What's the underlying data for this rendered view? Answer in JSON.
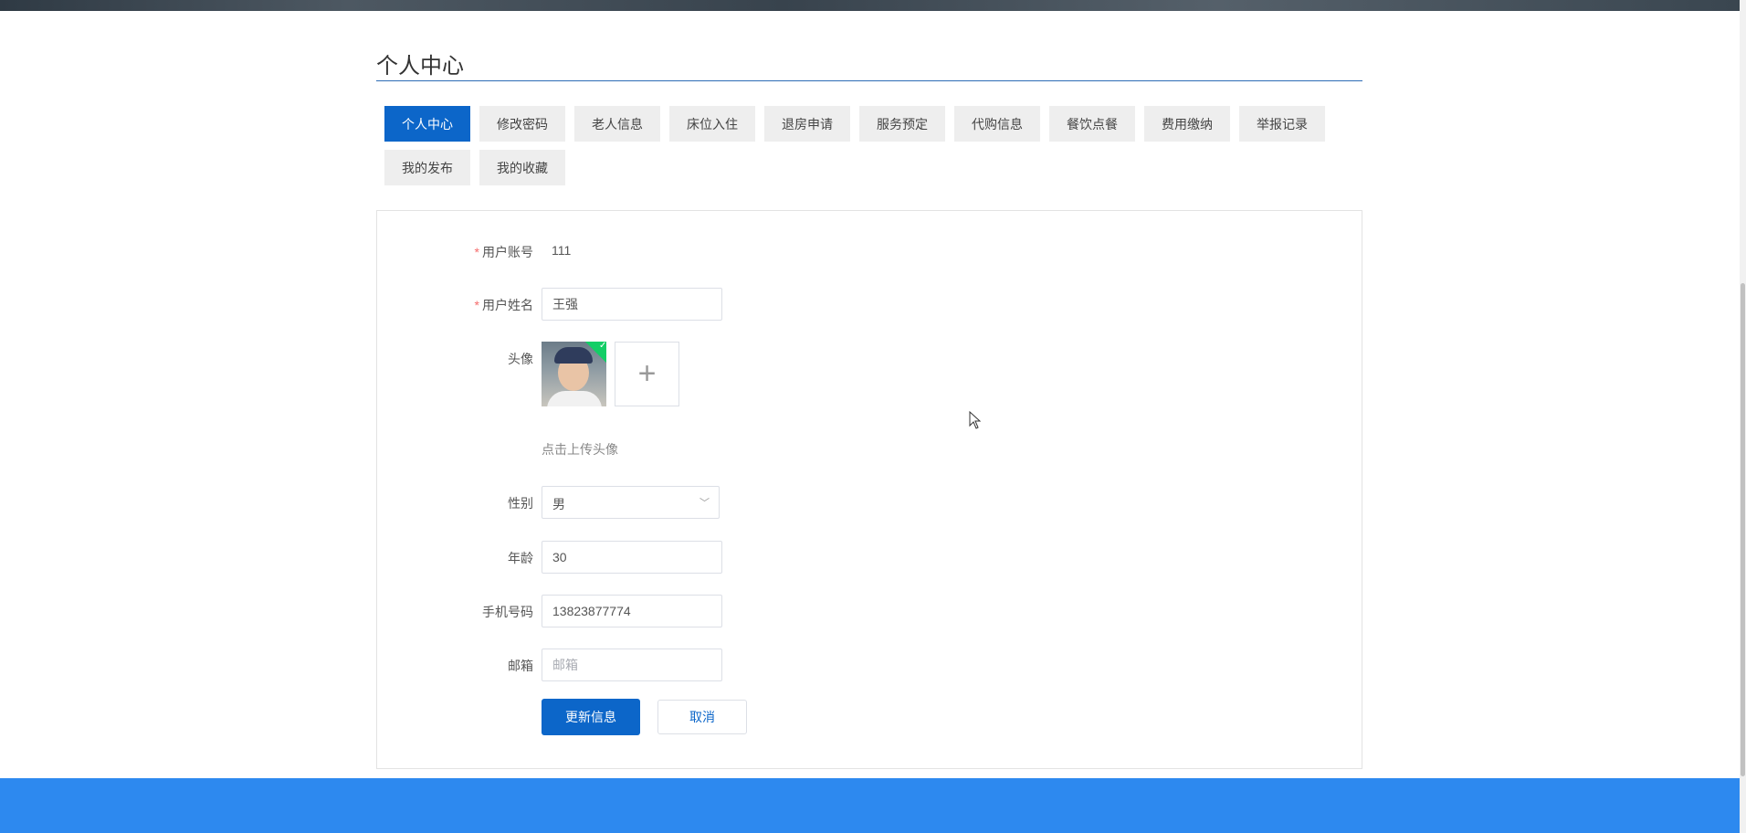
{
  "page": {
    "title": "个人中心"
  },
  "tabs": [
    {
      "label": "个人中心",
      "active": true
    },
    {
      "label": "修改密码"
    },
    {
      "label": "老人信息"
    },
    {
      "label": "床位入住"
    },
    {
      "label": "退房申请"
    },
    {
      "label": "服务预定"
    },
    {
      "label": "代购信息"
    },
    {
      "label": "餐饮点餐"
    },
    {
      "label": "费用缴纳"
    },
    {
      "label": "举报记录"
    },
    {
      "label": "我的发布"
    },
    {
      "label": "我的收藏"
    }
  ],
  "form": {
    "required_mark": "*",
    "account": {
      "label": "用户账号",
      "value": "111"
    },
    "name": {
      "label": "用户姓名",
      "value": "王强"
    },
    "avatar": {
      "label": "头像",
      "upload_hint": "点击上传头像",
      "add_symbol": "+"
    },
    "gender": {
      "label": "性别",
      "value": "男"
    },
    "age": {
      "label": "年龄",
      "value": "30"
    },
    "phone": {
      "label": "手机号码",
      "value": "13823877774"
    },
    "email": {
      "label": "邮箱",
      "value": "",
      "placeholder": "邮箱"
    },
    "submit_label": "更新信息",
    "cancel_label": "取消"
  },
  "colors": {
    "primary": "#0c66c9",
    "footer": "#2d89ef",
    "success": "#13ce66"
  }
}
